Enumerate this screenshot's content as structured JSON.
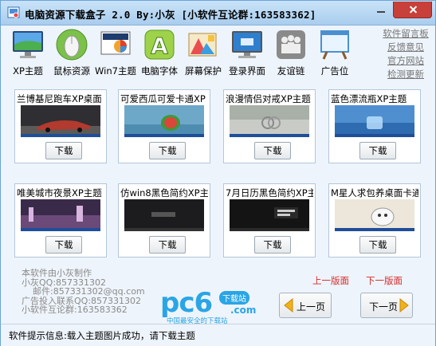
{
  "window": {
    "title": "电脑资源下载盒子 2.0 By:小灰 [小软件互论群:163583362]"
  },
  "toolbar": {
    "items": [
      {
        "label": "XP主题",
        "icon": "monitor-icon"
      },
      {
        "label": "鼠标资源",
        "icon": "mouse-icon"
      },
      {
        "label": "Win7主题",
        "icon": "win7-theme-icon"
      },
      {
        "label": "电脑字体",
        "icon": "font-icon"
      },
      {
        "label": "屏幕保护",
        "icon": "screensaver-icon"
      },
      {
        "label": "登录界面",
        "icon": "login-screen-icon"
      },
      {
        "label": "友谊链",
        "icon": "friends-icon"
      },
      {
        "label": "广告位",
        "icon": "ad-board-icon"
      }
    ]
  },
  "side_links": [
    "软件留言板",
    "反馈意见",
    "官方网站",
    "检测更新"
  ],
  "themes": [
    {
      "name": "兰博基尼跑车XP桌面",
      "button": "下载"
    },
    {
      "name": "可爱西瓜可爱卡通XP",
      "button": "下载"
    },
    {
      "name": "浪漫情侣对戒XP主题",
      "button": "下载"
    },
    {
      "name": "蓝色漂流瓶XP主题",
      "button": "下载"
    },
    {
      "name": "唯美城市夜景XP主题",
      "button": "下载"
    },
    {
      "name": "仿win8黑色简约XP主",
      "button": "下载"
    },
    {
      "name": "7月日历黑色简约XP主",
      "button": "下载"
    },
    {
      "name": "M星人求包养桌面卡通",
      "button": "下载"
    }
  ],
  "info_lines": [
    "本软件由小灰制作",
    "小灰QQ:857331302",
    "    邮件:857331302@qq.com",
    "广告投入联系QQ:857331302",
    "小软件互论群:163583362"
  ],
  "pagination": {
    "prev_link": "上一版面",
    "next_link": "下一版面",
    "prev_button": "上一页",
    "next_button": "下一页"
  },
  "logo": {
    "main": "pc6",
    "domain": ".com",
    "badge": "下载站",
    "tagline": "中国最安全的下载站"
  },
  "status": "软件提示信息:载入主题图片成功，请下载主题",
  "colors": {
    "title_bar": "#b9d8f3",
    "close_button": "#c7403a",
    "link_red": "#d42b2b",
    "logo_blue": "#2aa5e6"
  }
}
